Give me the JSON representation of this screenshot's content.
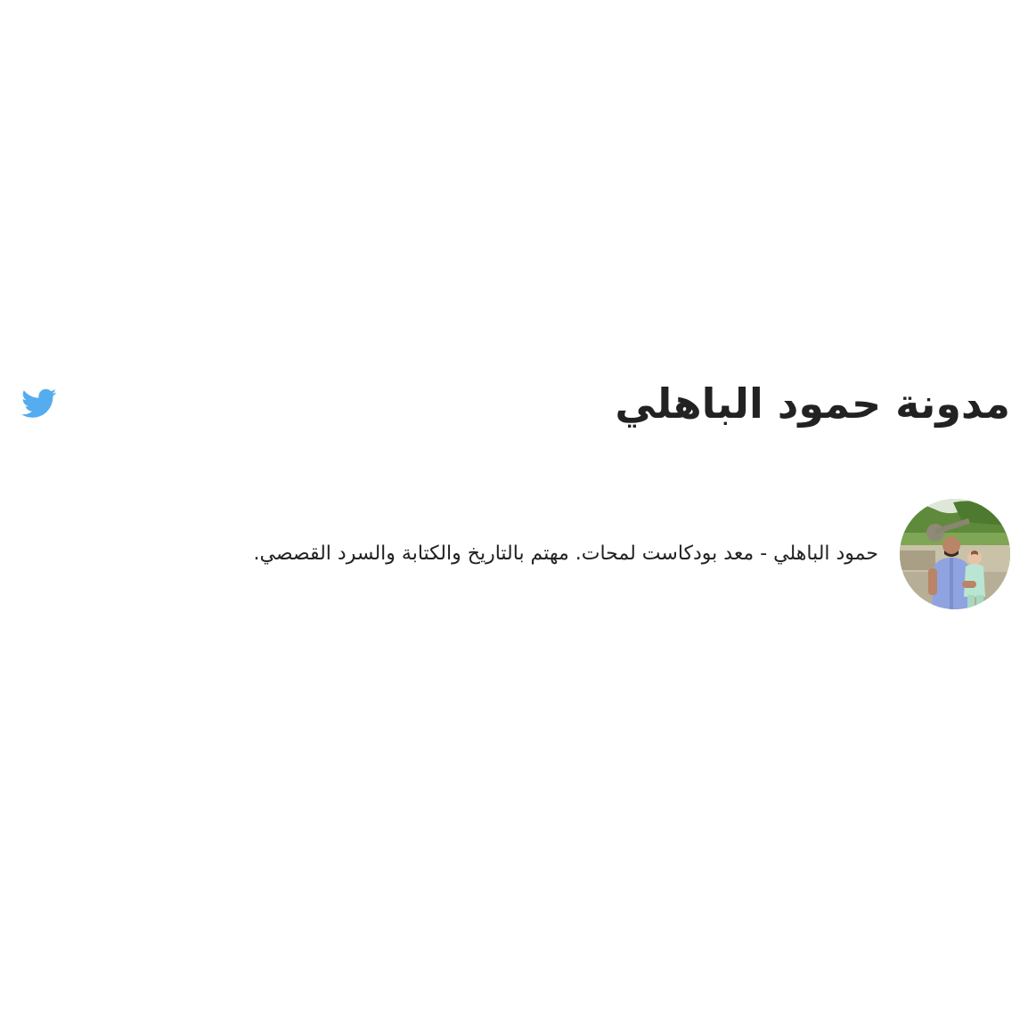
{
  "header": {
    "title": "مدونة حمود الباهلي",
    "twitter_icon": "twitter-bird-icon",
    "twitter_color": "#55acee"
  },
  "bio": {
    "avatar_icon": "author-photo",
    "text": "حمود الباهلي - معد بودكاست لمحات. مهتم بالتاريخ والكتابة والسرد القصصي."
  }
}
